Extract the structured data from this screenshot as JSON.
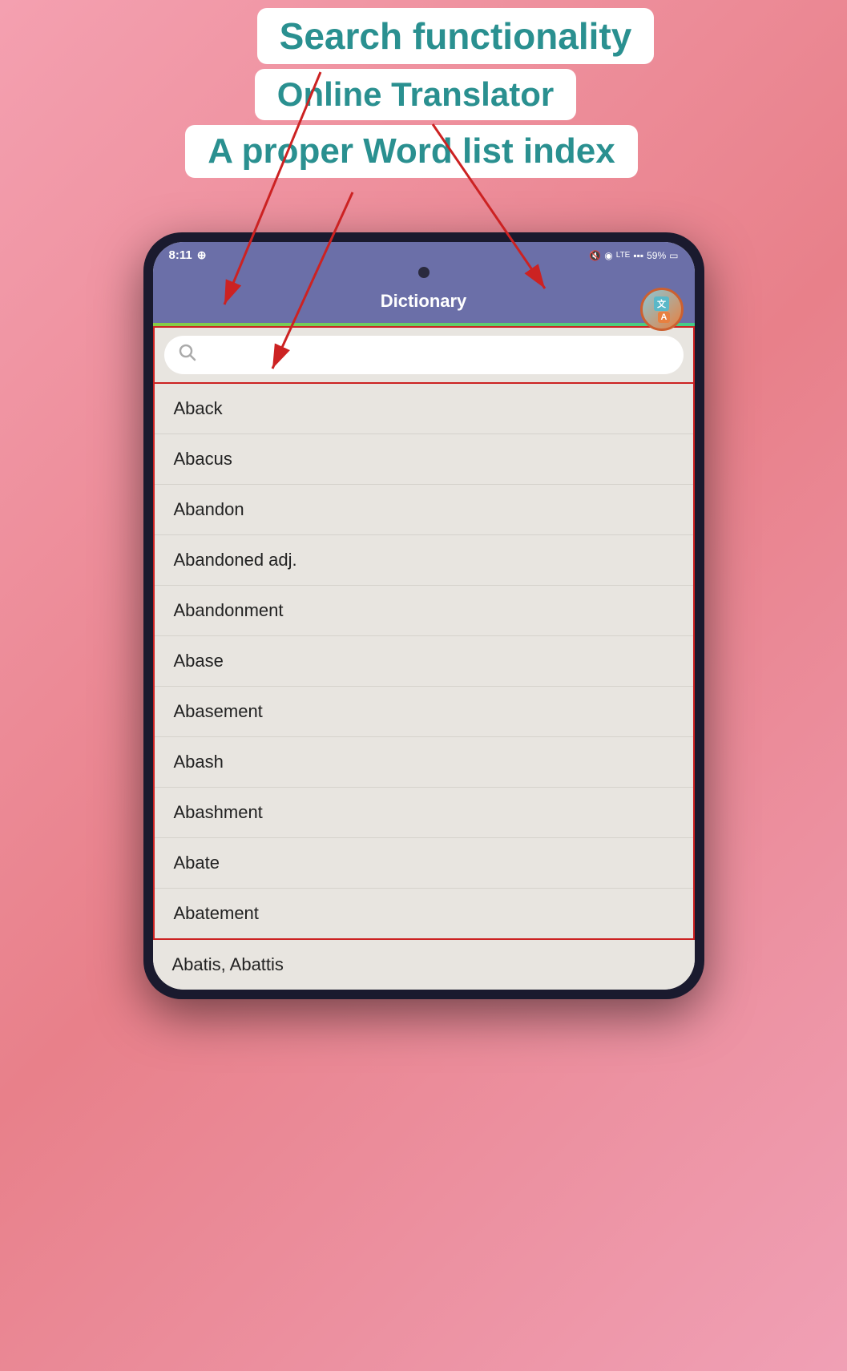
{
  "annotations": {
    "search_label": "Search functionality",
    "translator_label": "Online Translator",
    "wordlist_label": "A proper Word list index"
  },
  "status_bar": {
    "time": "8:11",
    "whatsapp_icon": "whatsapp",
    "mute_icon": "mute",
    "wifi_icon": "wifi",
    "lte_icon": "LTE",
    "signal_icon": "signal",
    "battery": "59%",
    "battery_icon": "battery"
  },
  "app": {
    "title": "Dictionary",
    "translate_button_label": "translate"
  },
  "search": {
    "placeholder": "",
    "search_icon": "search"
  },
  "word_list": {
    "words": [
      "Aback",
      "Abacus",
      "Abandon",
      "Abandoned adj.",
      "Abandonment",
      "Abase",
      "Abasement",
      "Abash",
      "Abashment",
      "Abate",
      "Abatement"
    ],
    "last_word": "Abatis, Abattis"
  }
}
